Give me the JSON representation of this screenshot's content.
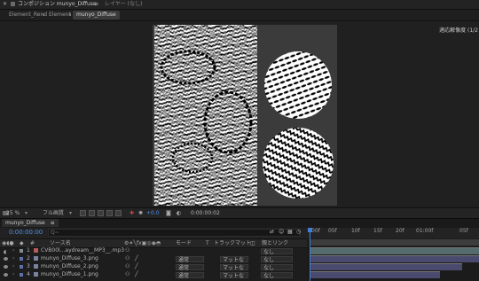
{
  "panel_header": {
    "title": "コンポジション munyo_Diffuse",
    "menu": "≡",
    "layer_panel": "レイヤー (なし)"
  },
  "breadcrumbs": [
    "Element_Rend",
    "Element",
    "munyo_Diffuse"
  ],
  "viewer": {
    "render_status": "適応解像度 (1/2"
  },
  "viewer_toolbar": {
    "zoom": "25 %",
    "resolution": "フル画質",
    "exposure": "+0.0",
    "timecode": "0:00:00:02"
  },
  "timeline": {
    "tab_label": "munyo_Diffuse",
    "tab_menu": "≡",
    "current_time": "0:00:00:00",
    "search_placeholder": "Q~",
    "columns": {
      "source_name": "ソース名",
      "mode": "モード",
      "t": "T",
      "track_matte": "トラックマット",
      "parent": "親とリンク"
    },
    "ruler_ticks": [
      "00f",
      "05f",
      "10f",
      "15f",
      "20f",
      "01:00f",
      "05f"
    ],
    "layers": [
      {
        "num": "1",
        "name": "CVB00l...aydream__MP3__.mp3",
        "mode": "",
        "matte": "",
        "parent": "なし",
        "type": "audio"
      },
      {
        "num": "2",
        "name": "munyo_Diffuse_3.png",
        "mode": "通常",
        "matte": "マットな",
        "parent": "なし",
        "type": "image"
      },
      {
        "num": "3",
        "name": "munyo_Diffuse_2.png",
        "mode": "通常",
        "matte": "マットな",
        "parent": "なし",
        "type": "image"
      },
      {
        "num": "4",
        "name": "munyo_Diffuse_1.png",
        "mode": "通常",
        "matte": "マットな",
        "parent": "なし",
        "type": "image"
      }
    ]
  },
  "colors": {
    "accent": "#3f7fd9",
    "label_purple": "#5a72a8"
  }
}
